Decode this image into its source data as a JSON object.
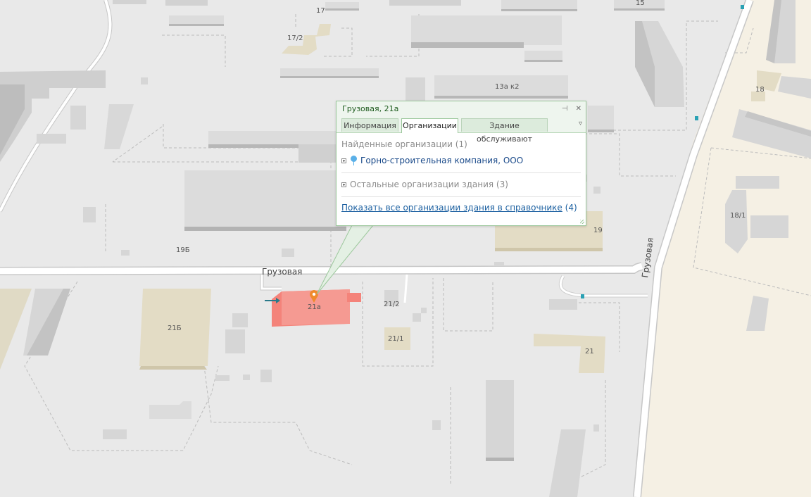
{
  "popup": {
    "title": "Грузовая, 21а",
    "pin_symbol": "⊣",
    "close_symbol": "✕",
    "tabs": [
      "Информация",
      "Организации",
      "Здание обслуживают"
    ],
    "active_tab": "Организации",
    "menu_symbol": "▿",
    "found_title": "Найденные организации (1)",
    "org_name": "Горно-строительная компания, ООО",
    "rest_label": "Остальные организации здания (3)",
    "show_all_link": "Показать все организации здания в справочнике",
    "show_all_count": "(4)"
  },
  "map": {
    "streets": {
      "main": "Грузовая",
      "vertical": "Грузовая"
    },
    "buildings": [
      "17",
      "15",
      "17/2",
      "13а к2",
      "18",
      "18/1",
      "19",
      "19Б",
      "21а",
      "21/2",
      "21/1",
      "21Б",
      "21"
    ],
    "selected_building": "21а",
    "colors": {
      "selected": "#f4837a",
      "marker": "#f08a2c",
      "popup_border": "#9cc89c",
      "bus_stop": "#2aa1b4"
    }
  }
}
